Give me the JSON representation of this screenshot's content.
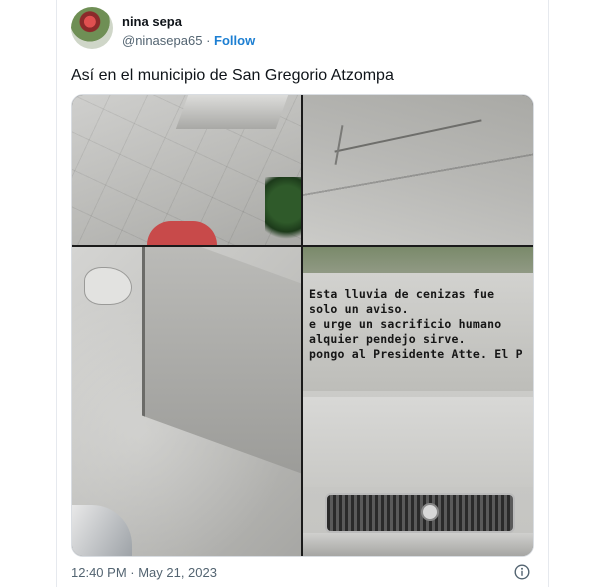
{
  "author": {
    "name": "nina sepa",
    "handle": "@ninasepa65",
    "separator": "·",
    "follow_label": "Follow"
  },
  "tweet": {
    "text": "Así en el municipio de San Gregorio Atzompa",
    "timestamp": "12:40 PM · May 21, 2023"
  },
  "media": {
    "photos": [
      {
        "description_name": "ash-covered-pavement-photo"
      },
      {
        "description_name": "ash-covered-ground-photo"
      },
      {
        "description_name": "ash-covered-car-hood-photo"
      },
      {
        "description_name": "ash-written-windshield-photo"
      }
    ],
    "windshield_text": "Esta lluvia de cenizas fue\nsolo un aviso.\ne urge un sacrificio humano\nalquier pendejo sirve.\npongo al Presidente Atte. El P"
  },
  "colors": {
    "follow": "#1d7fd2",
    "secondary_text": "#536471",
    "primary_text": "#0f1419"
  },
  "icons": {
    "info": "info-icon"
  }
}
